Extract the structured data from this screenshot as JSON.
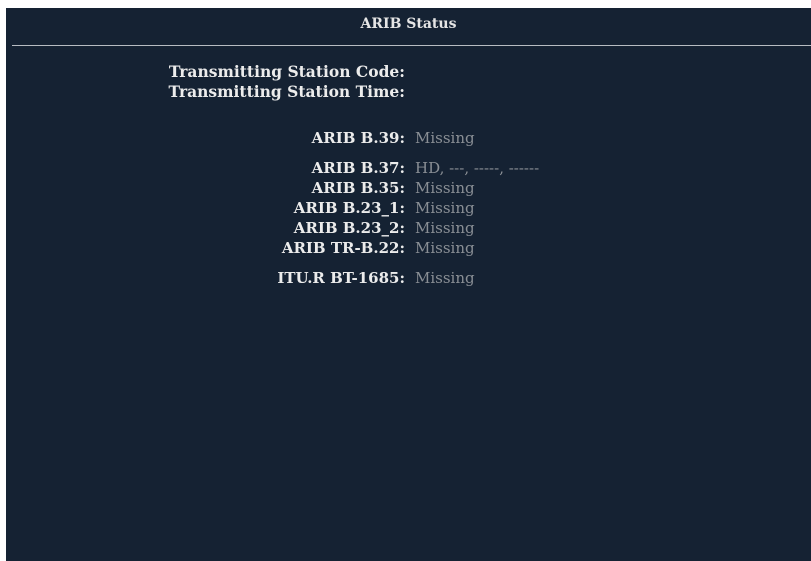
{
  "panel": {
    "title": "ARIB Status"
  },
  "station": {
    "code_label": "Transmitting Station Code:",
    "code_value": "",
    "time_label": "Transmitting Station Time:",
    "time_value": ""
  },
  "rows": [
    {
      "label": "ARIB B.39:",
      "value": "Missing"
    },
    {
      "label": "ARIB B.37:",
      "value": "HD, ---, -----, ------"
    },
    {
      "label": "ARIB B.35:",
      "value": "Missing"
    },
    {
      "label": "ARIB B.23_1:",
      "value": "Missing"
    },
    {
      "label": "ARIB B.23_2:",
      "value": "Missing"
    },
    {
      "label": "ARIB TR-B.22:",
      "value": "Missing"
    },
    {
      "label": "ITU.R BT-1685:",
      "value": "Missing"
    }
  ],
  "colors": {
    "background": "#152233",
    "label": "#ececec",
    "value": "#8a8f95",
    "divider": "#b7bcc2"
  }
}
